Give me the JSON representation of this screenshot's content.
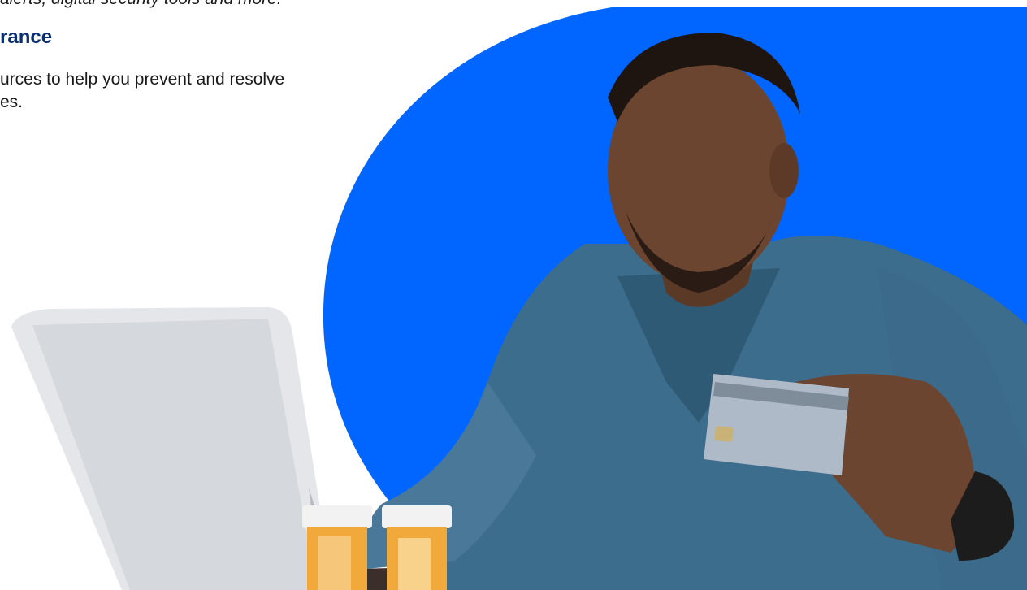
{
  "section": {
    "top_line": "alerts, digital security tools and more.",
    "heading": "rance",
    "body": "urces to help you prevent and resolve\nes."
  },
  "hero": {
    "image": "man-holding-credit-card-at-laptop",
    "accent_color": "#0066ff"
  }
}
